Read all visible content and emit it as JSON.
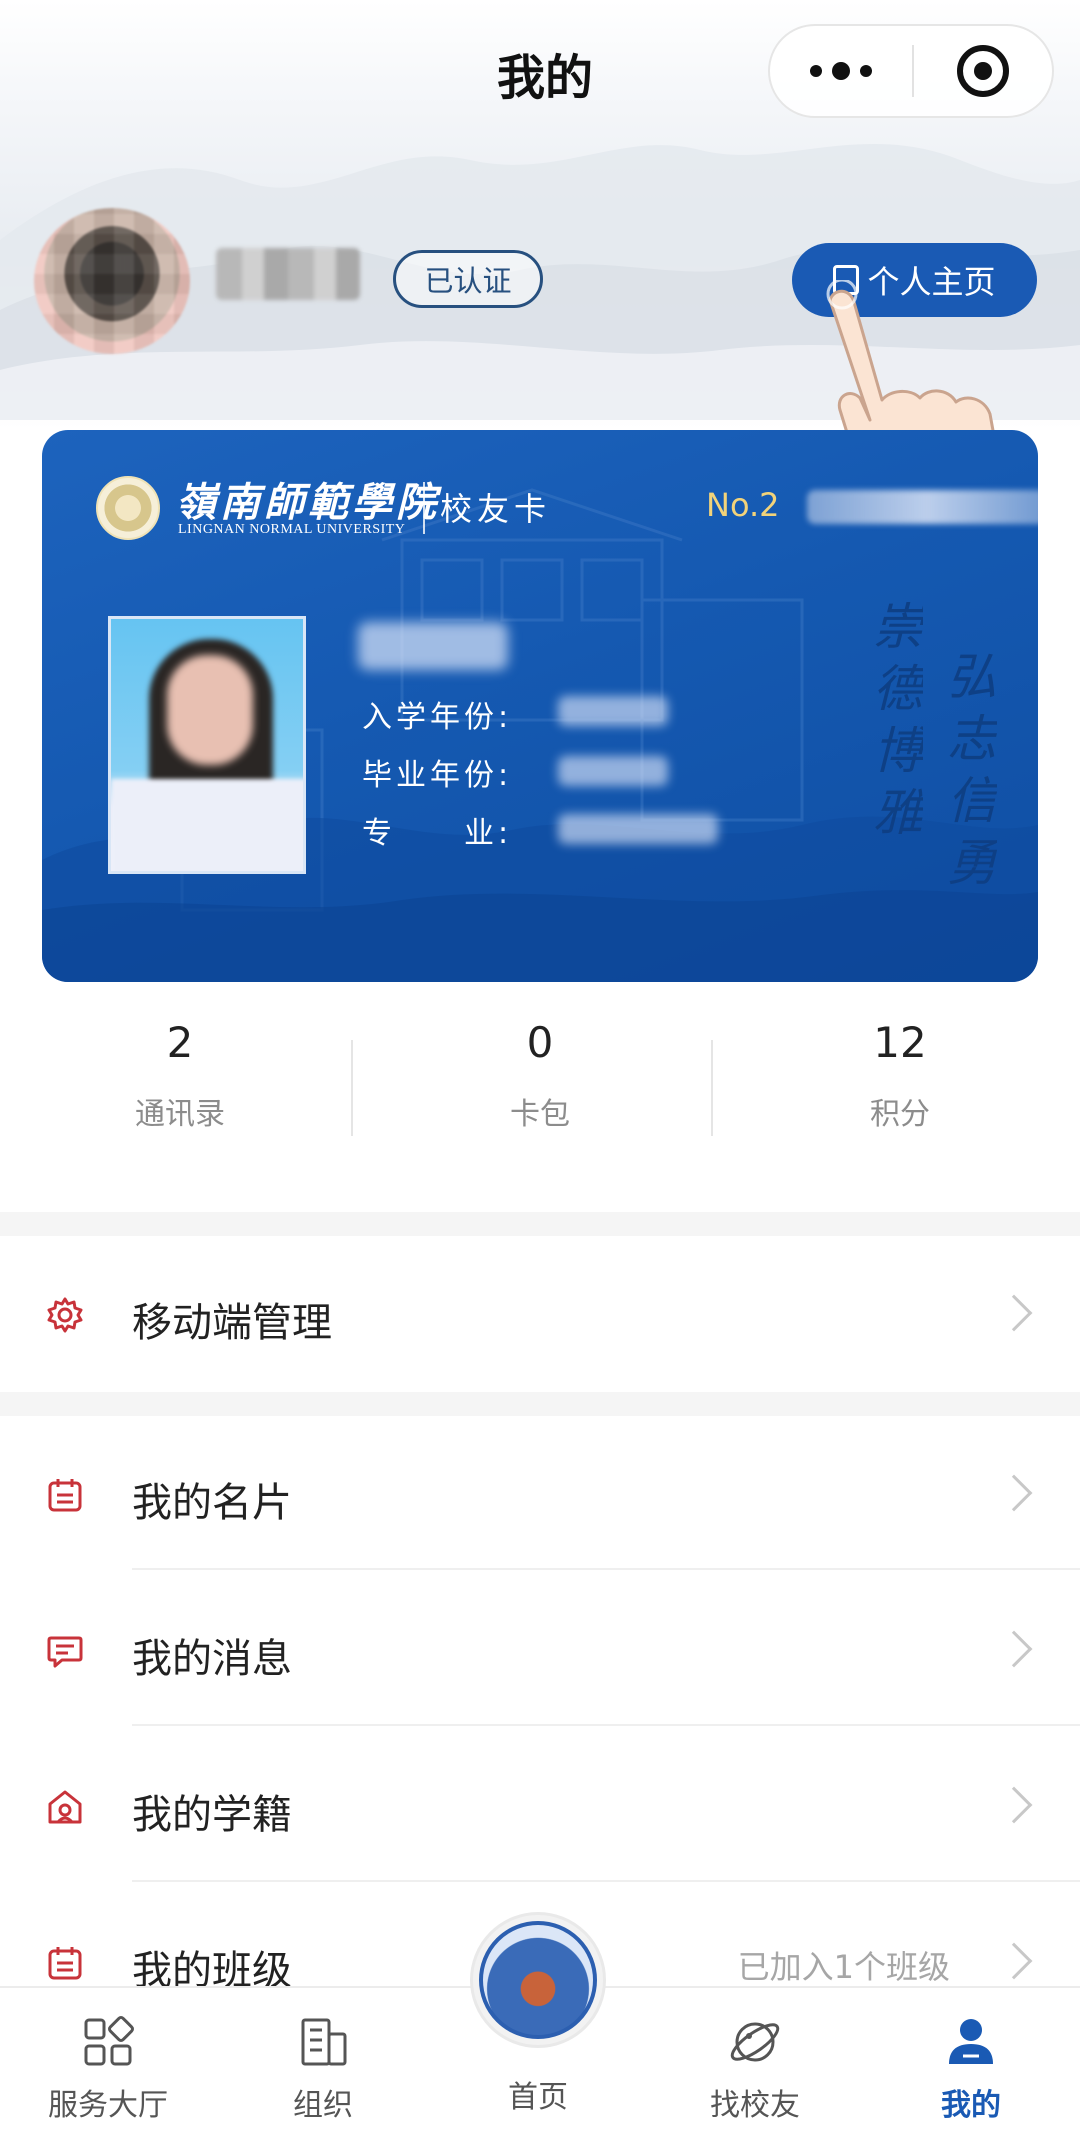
{
  "header": {
    "title": "我的",
    "more_icon": "more-dots-icon",
    "close_icon": "target-icon"
  },
  "profile": {
    "verified_label": "已认证",
    "homepage_label": "个人主页"
  },
  "card": {
    "school_name_cn": "嶺南師範學院",
    "school_name_en": "LINGNAN NORMAL UNIVERSITY",
    "card_type": "校友卡",
    "number_prefix": "No.2",
    "fields": [
      {
        "label": "入学年份:"
      },
      {
        "label": "毕业年份:"
      },
      {
        "label": "专　　业:"
      }
    ],
    "motto_left": "崇德博雅",
    "motto_right": "弘志信勇",
    "color": "#1559b1"
  },
  "stats": [
    {
      "value": "2",
      "label": "通讯录"
    },
    {
      "value": "0",
      "label": "卡包"
    },
    {
      "value": "12",
      "label": "积分"
    }
  ],
  "menu": {
    "mobile_manage": {
      "label": "移动端管理",
      "icon": "gear-icon"
    },
    "items": [
      {
        "label": "我的名片",
        "icon": "calendar-icon"
      },
      {
        "label": "我的消息",
        "icon": "message-icon"
      },
      {
        "label": "我的学籍",
        "icon": "graduation-cap-icon"
      },
      {
        "label": "我的班级",
        "icon": "calendar-icon",
        "extra": "已加入1个班级"
      }
    ]
  },
  "tabbar": {
    "tabs": [
      {
        "label": "服务大厅",
        "icon": "grid-icon"
      },
      {
        "label": "组织",
        "icon": "building-icon"
      },
      {
        "label": "首页",
        "icon": "school-emblem-icon"
      },
      {
        "label": "找校友",
        "icon": "planet-icon"
      },
      {
        "label": "我的",
        "icon": "person-icon",
        "active": true
      }
    ],
    "active_color": "#1a5ab4"
  },
  "colors": {
    "accent_red": "#c8333a",
    "primary_blue": "#1a5ab4"
  }
}
